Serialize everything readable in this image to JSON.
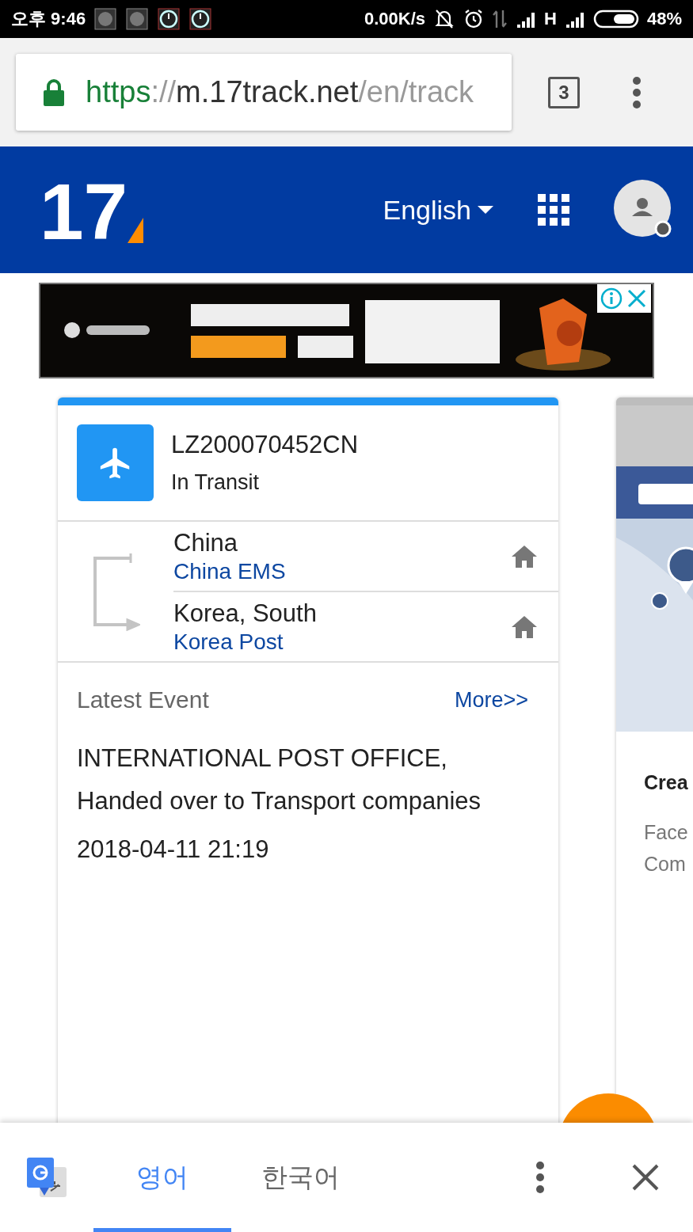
{
  "status_bar": {
    "time": "오후 9:46",
    "net_speed": "0.00K/s",
    "network": "H",
    "battery": "48%"
  },
  "browser": {
    "url": {
      "scheme": "https",
      "separator": "://",
      "host": "m.17track.net",
      "path": "/en/track"
    },
    "tab_count": "3"
  },
  "header": {
    "logo": "17",
    "language": "English"
  },
  "tracking_card": {
    "number": "LZ200070452CN",
    "status": "In Transit",
    "route": [
      {
        "country": "China",
        "carrier": "China EMS"
      },
      {
        "country": "Korea, South",
        "carrier": "Korea Post"
      }
    ],
    "latest_event": {
      "title": "Latest Event",
      "more": "More>>",
      "description": "INTERNATIONAL POST OFFICE, Handed over to Transport companies",
      "time": "2018-04-11 21:19"
    }
  },
  "side_card": {
    "title": "Crea",
    "lines": [
      "Face",
      "Com"
    ]
  },
  "translate_bar": {
    "tabs": [
      {
        "label": "영어",
        "selected": true
      },
      {
        "label": "한국어",
        "selected": false
      }
    ]
  }
}
